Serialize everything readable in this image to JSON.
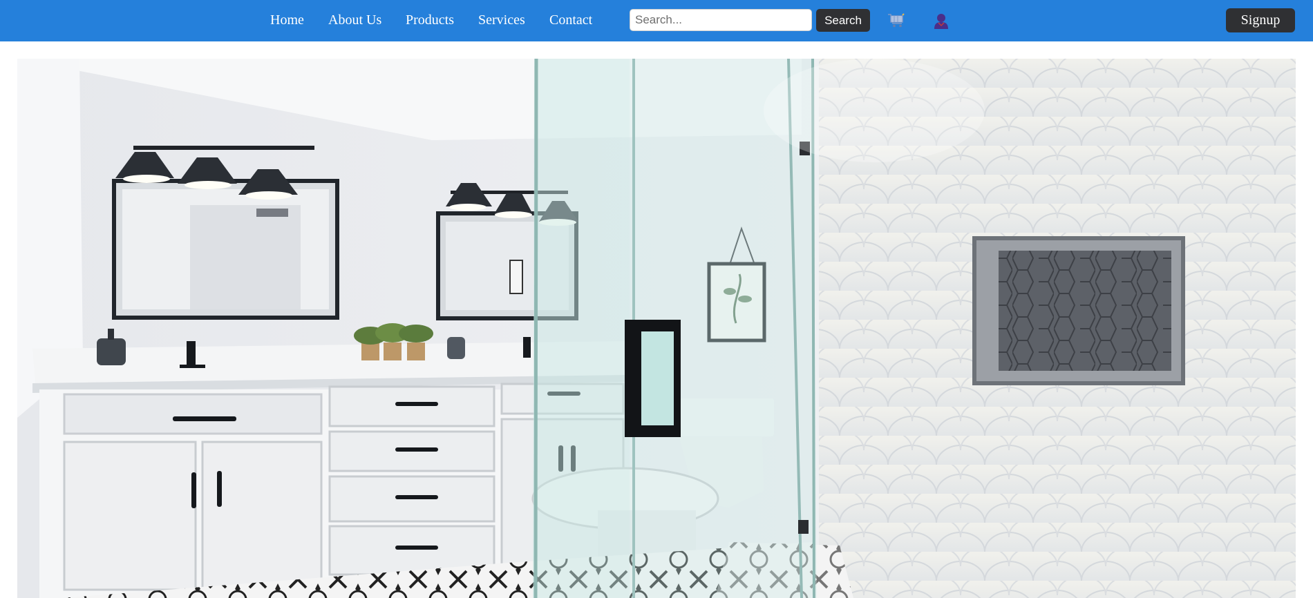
{
  "nav": {
    "links": [
      "Home",
      "About Us",
      "Products",
      "Services",
      "Contact"
    ]
  },
  "search": {
    "placeholder": "Search...",
    "value": "",
    "button_label": "Search"
  },
  "icons": {
    "cart": "shopping-cart-icon",
    "user": "user-profile-icon"
  },
  "signup_label": "Signup",
  "hero": {
    "image": "bathroom-interior-photo"
  },
  "colors": {
    "navbar": "#2580db",
    "button": "#2f3033",
    "nav_text": "#ffffff",
    "user_icon": "#4a2f8a"
  }
}
